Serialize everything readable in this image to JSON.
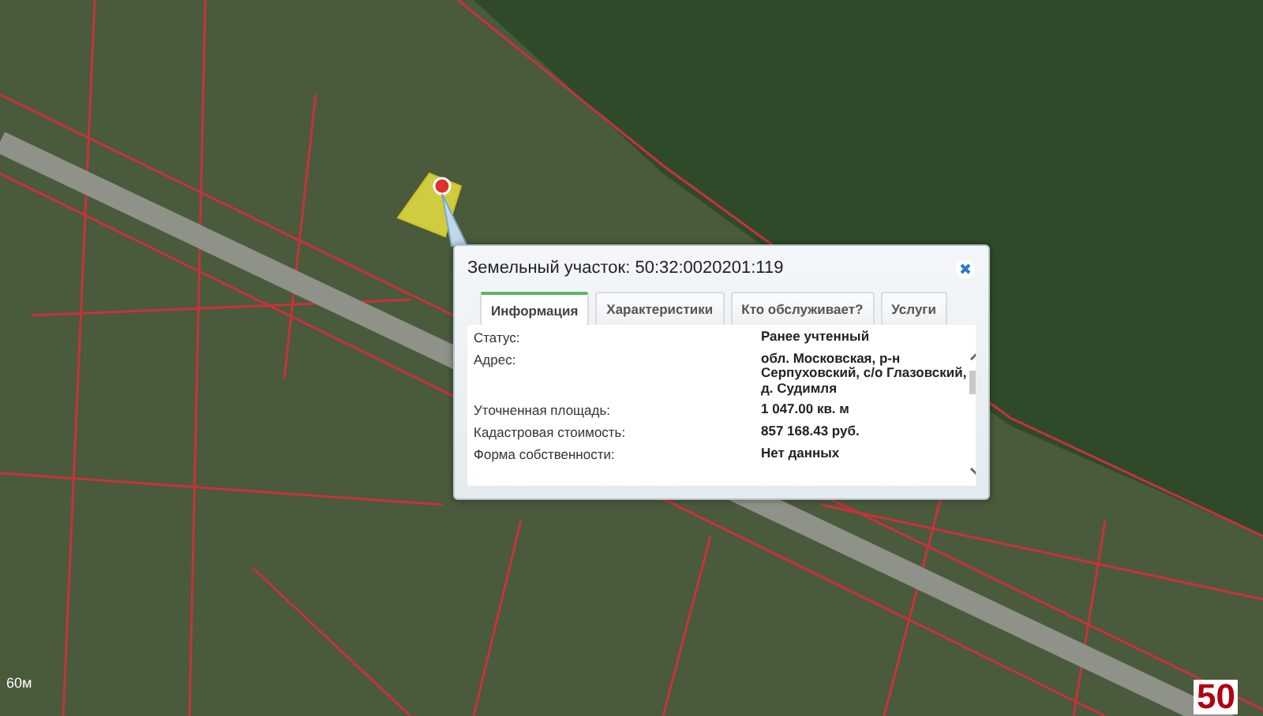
{
  "map": {
    "scale_label": "60м",
    "region_label": "50"
  },
  "popup": {
    "title": "Земельный участок: 50:32:0020201:119",
    "tabs": [
      {
        "label": "Информация",
        "selected": true
      },
      {
        "label": "Характеристики",
        "selected": false
      },
      {
        "label": "Кто обслуживает?",
        "selected": false
      },
      {
        "label": "Услуги",
        "selected": false
      }
    ],
    "fields": [
      {
        "label": "Статус:",
        "value": "Ранее учтенный"
      },
      {
        "label": "Адрес:",
        "value": "обл. Московская, р-н Серпуховский, с/о Глазовский, д. Судимля"
      },
      {
        "label": "Уточненная площадь:",
        "value": "1 047.00 кв. м"
      },
      {
        "label": "Кадастровая стоимость:",
        "value": "857 168.43 руб."
      },
      {
        "label": "Форма собственности:",
        "value": "Нет данных"
      }
    ]
  }
}
